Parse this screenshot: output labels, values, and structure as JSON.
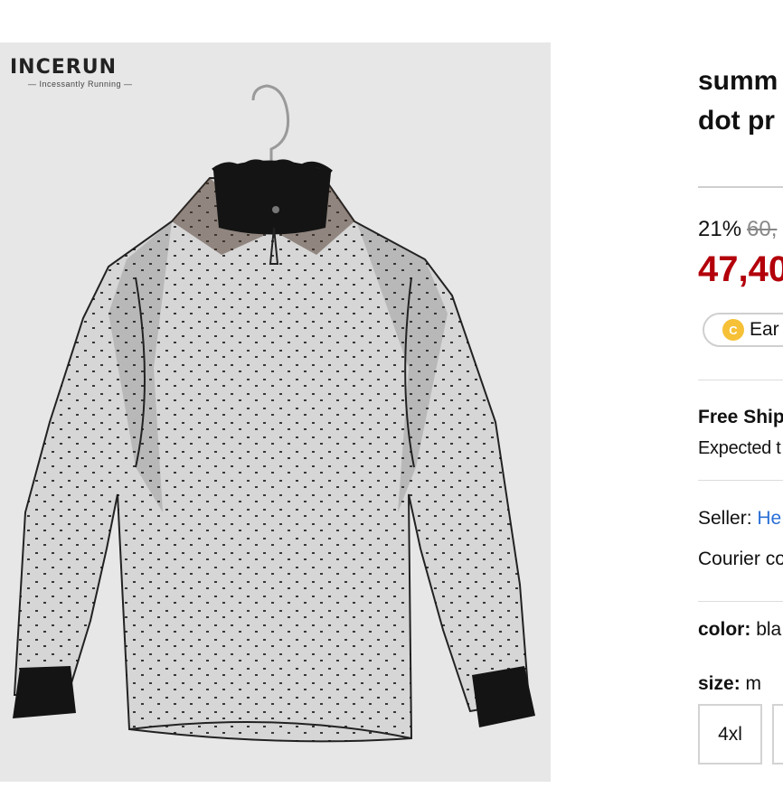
{
  "brand": {
    "name": "INCERUN",
    "tagline": "— Incessantly Running —"
  },
  "product": {
    "title_line1": "summ",
    "title_line2": "dot pr"
  },
  "price": {
    "discount": "21%",
    "original": "60,",
    "sale": "47,40"
  },
  "rewards": {
    "label": "Ear",
    "icon_letter": "C"
  },
  "shipping": {
    "title": "Free Ship",
    "expected": "Expected t"
  },
  "seller": {
    "label": "Seller:",
    "name": "He"
  },
  "courier": {
    "text": "Courier co"
  },
  "options": {
    "color_label": "color:",
    "color_value": "bla",
    "size_label": "size:",
    "size_value": "m",
    "sizes": [
      "4xl",
      ""
    ]
  },
  "colors": {
    "accent_price": "#b3000b",
    "link": "#2a6fd6",
    "coin": "#f6c137"
  }
}
